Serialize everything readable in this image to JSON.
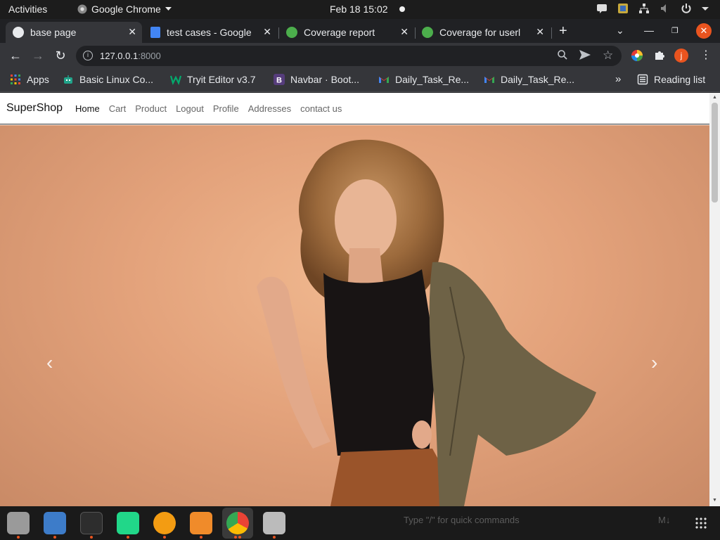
{
  "system_bar": {
    "activities": "Activities",
    "app_name": "Google Chrome",
    "clock": "Feb 18  15:02"
  },
  "tabs": [
    {
      "title": "base page",
      "active": true
    },
    {
      "title": "test cases - Google",
      "active": false
    },
    {
      "title": "Coverage report",
      "active": false
    },
    {
      "title": "Coverage for userl",
      "active": false
    }
  ],
  "address_bar": {
    "host": "127.0.0.1",
    "port": ":8000"
  },
  "profile_initial": "j",
  "bookmarks": [
    {
      "label": "Apps",
      "icon": "apps-grid-icon"
    },
    {
      "label": "Basic Linux Co...",
      "icon": "robot-icon"
    },
    {
      "label": "Tryit Editor v3.7",
      "icon": "w3schools-icon"
    },
    {
      "label": "Navbar · Boot...",
      "icon": "bootstrap-icon"
    },
    {
      "label": "Daily_Task_Re...",
      "icon": "gmail-icon"
    },
    {
      "label": "Daily_Task_Re...",
      "icon": "gmail-icon"
    }
  ],
  "reading_list": "Reading list",
  "site": {
    "brand": "SuperShop",
    "nav": [
      {
        "label": "Home",
        "active": true
      },
      {
        "label": "Cart",
        "active": false
      },
      {
        "label": "Product",
        "active": false
      },
      {
        "label": "Logout",
        "active": false
      },
      {
        "label": "Profile",
        "active": false
      },
      {
        "label": "Addresses",
        "active": false
      },
      {
        "label": "contact us",
        "active": false
      }
    ],
    "carousel_prev": "‹",
    "carousel_next": "›"
  },
  "dock": {
    "hint": "Type \"/\" for quick commands",
    "hint_right": "M↓"
  }
}
